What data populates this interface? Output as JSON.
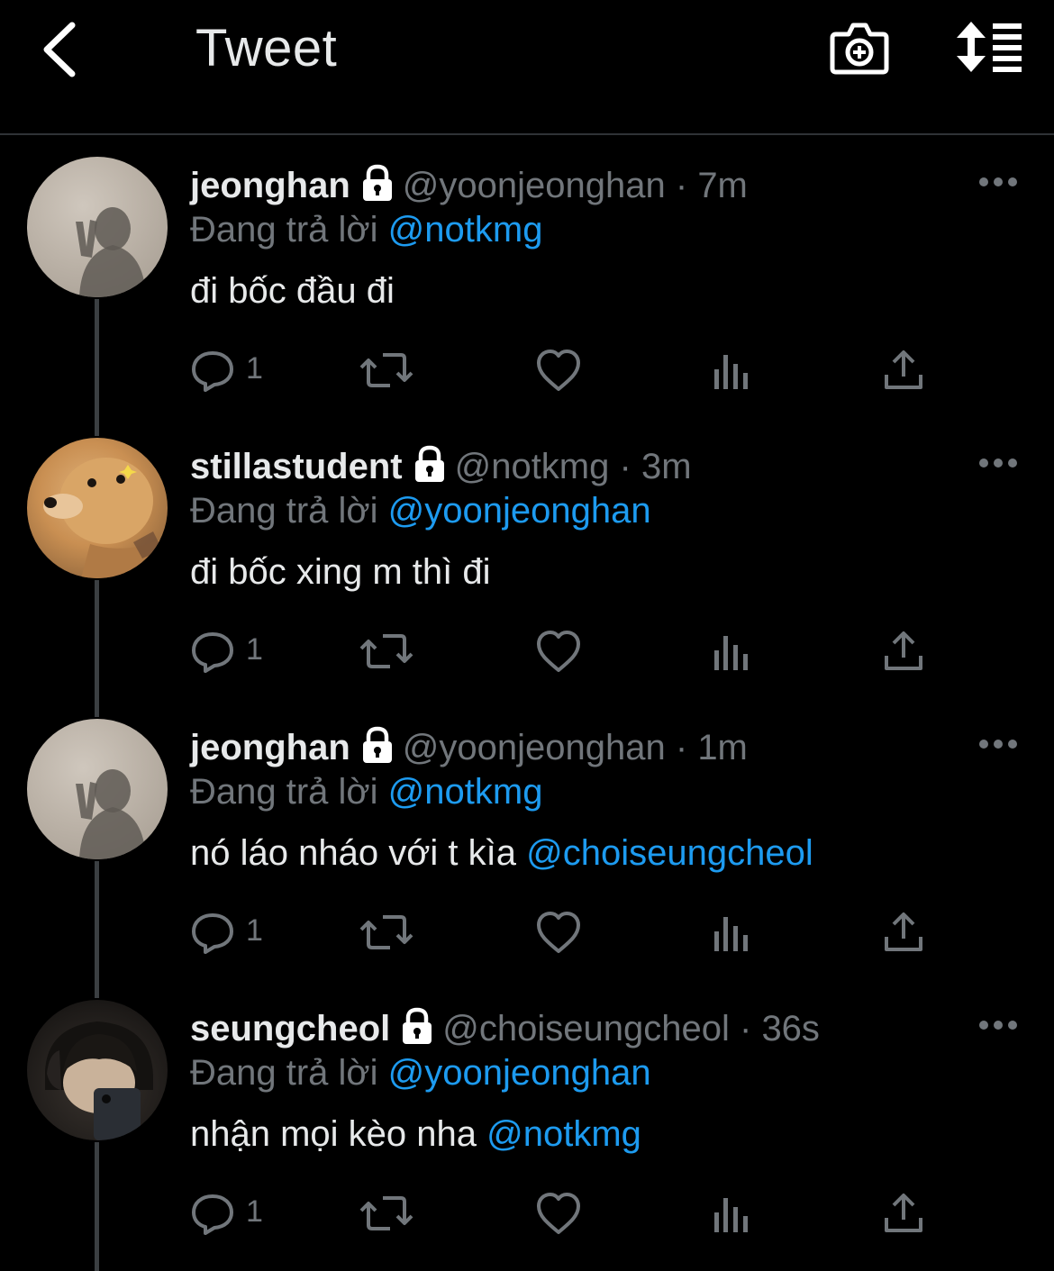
{
  "header": {
    "title": "Tweet"
  },
  "reply_prefix": "Đang trả lời",
  "tweets": [
    {
      "name": "jeonghan",
      "handle": "@yoonjeonghan",
      "separator": "·",
      "time": "7m",
      "replying_to": "@notkmg",
      "text": "đi bốc đầu đi",
      "mention": "",
      "reply_count": "1"
    },
    {
      "name": "stillastudent",
      "handle": "@notkmg",
      "separator": "·",
      "time": "3m",
      "replying_to": "@yoonjeonghan",
      "text": "đi bốc xing m thì đi",
      "mention": "",
      "reply_count": "1"
    },
    {
      "name": "jeonghan",
      "handle": "@yoonjeonghan",
      "separator": "·",
      "time": "1m",
      "replying_to": "@notkmg",
      "text": "nó láo nháo với t kìa ",
      "mention": "@choiseungcheol",
      "reply_count": "1"
    },
    {
      "name": "seungcheol",
      "handle": "@choiseungcheol",
      "separator": "·",
      "time": "36s",
      "replying_to": "@yoonjeonghan",
      "text": "nhận mọi kèo nha ",
      "mention": "@notkmg",
      "reply_count": "1"
    }
  ],
  "icons": {
    "back": "chevron-left-icon",
    "camera": "camera-plus-icon",
    "sort": "sort-list-icon",
    "lock": "lock-icon",
    "more": "more-horizontal-icon",
    "reply": "comment-icon",
    "retweet": "retweet-icon",
    "like": "heart-icon",
    "views": "views-chart-icon",
    "share": "share-icon"
  },
  "colors": {
    "background": "#000000",
    "text": "#e7e9ea",
    "muted": "#71767b",
    "link": "#1d9bf0"
  }
}
